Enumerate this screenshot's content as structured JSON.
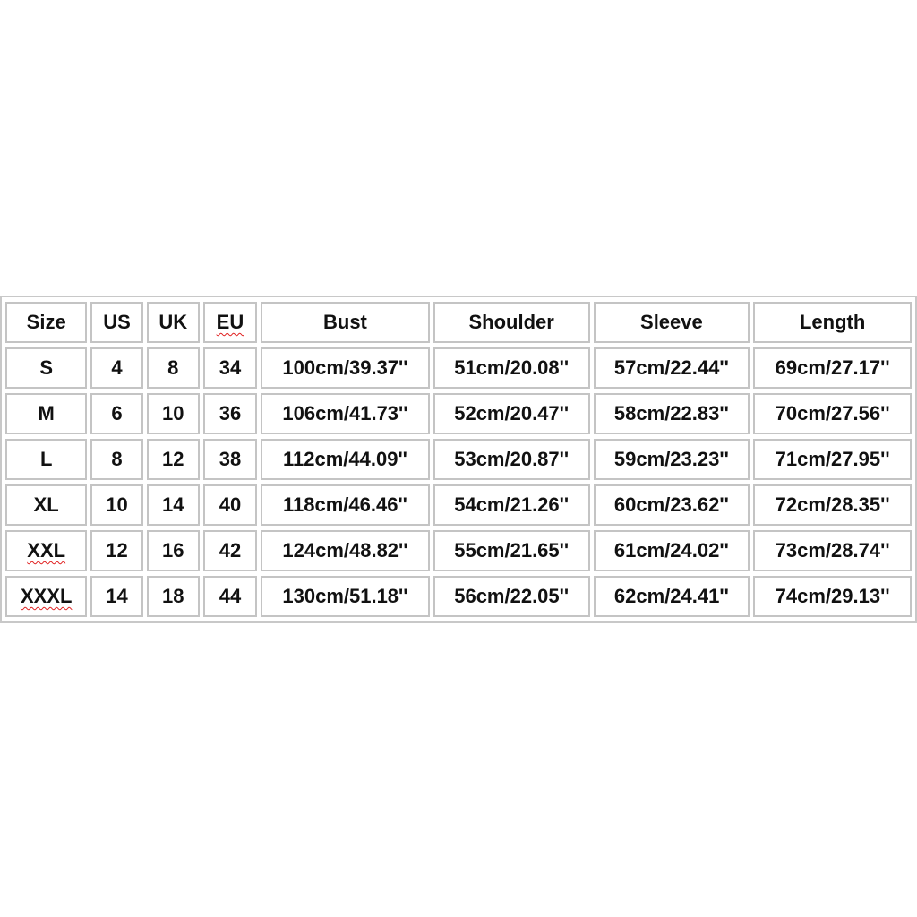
{
  "headers": [
    "Size",
    "US",
    "UK",
    "EU",
    "Bust",
    "Shoulder",
    "Sleeve",
    "Length"
  ],
  "rows": [
    [
      "S",
      "4",
      "8",
      "34",
      "100cm/39.37''",
      "51cm/20.08''",
      "57cm/22.44''",
      "69cm/27.17''"
    ],
    [
      "M",
      "6",
      "10",
      "36",
      "106cm/41.73''",
      "52cm/20.47''",
      "58cm/22.83''",
      "70cm/27.56''"
    ],
    [
      "L",
      "8",
      "12",
      "38",
      "112cm/44.09''",
      "53cm/20.87''",
      "59cm/23.23''",
      "71cm/27.95''"
    ],
    [
      "XL",
      "10",
      "14",
      "40",
      "118cm/46.46''",
      "54cm/21.26''",
      "60cm/23.62''",
      "72cm/28.35''"
    ],
    [
      "XXL",
      "12",
      "16",
      "42",
      "124cm/48.82''",
      "55cm/21.65''",
      "61cm/24.02''",
      "73cm/28.74''"
    ],
    [
      "XXXL",
      "14",
      "18",
      "44",
      "130cm/51.18''",
      "56cm/22.05''",
      "62cm/24.41''",
      "74cm/29.13''"
    ]
  ],
  "spellcheck_marked": [
    "EU",
    "XXL",
    "XXXL"
  ],
  "colors": {
    "border": "#c4c4c4",
    "spellcheck": "#e02020",
    "text": "#111111"
  }
}
